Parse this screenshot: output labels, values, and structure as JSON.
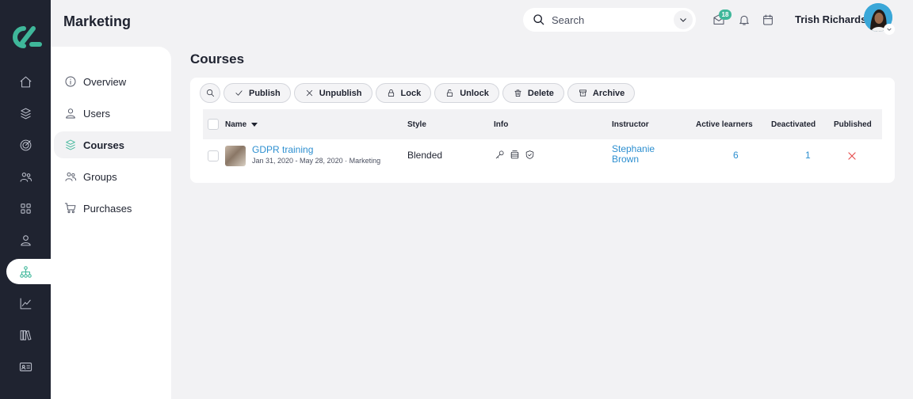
{
  "app": {
    "section_title": "Marketing"
  },
  "rail": {
    "items": [
      {
        "icon": "home-icon"
      },
      {
        "icon": "courses-icon"
      },
      {
        "icon": "target-icon"
      },
      {
        "icon": "groups-icon"
      },
      {
        "icon": "grid-icon"
      },
      {
        "icon": "user-icon"
      },
      {
        "icon": "branches-icon",
        "active": true
      },
      {
        "icon": "chart-icon"
      },
      {
        "icon": "library-icon"
      },
      {
        "icon": "id-card-icon"
      }
    ]
  },
  "subnav": {
    "items": [
      {
        "label": "Overview",
        "icon": "info-icon"
      },
      {
        "label": "Users",
        "icon": "user-icon"
      },
      {
        "label": "Courses",
        "icon": "courses-icon",
        "active": true
      },
      {
        "label": "Groups",
        "icon": "groups-icon"
      },
      {
        "label": "Purchases",
        "icon": "cart-icon"
      }
    ]
  },
  "header": {
    "search_placeholder": "Search",
    "message_badge": "18",
    "user_name": "Trish Richards"
  },
  "page": {
    "title": "Courses"
  },
  "toolbar": {
    "publish": "Publish",
    "unpublish": "Unpublish",
    "lock": "Lock",
    "unlock": "Unlock",
    "delete": "Delete",
    "archive": "Archive"
  },
  "table": {
    "columns": {
      "name": "Name",
      "style": "Style",
      "info": "Info",
      "instructor": "Instructor",
      "active_learners": "Active learners",
      "deactivated": "Deactivated",
      "published": "Published"
    },
    "rows": [
      {
        "name": "GDPR training",
        "meta": "Jan 31, 2020 - May 28, 2020 · Marketing",
        "style": "Blended",
        "instructor": "Stephanie Brown",
        "active_learners": "6",
        "deactivated": "1",
        "published": false
      }
    ]
  },
  "colors": {
    "accent": "#3fb79a",
    "link": "#2d8fd0",
    "rail": "#1f2330",
    "danger": "#e54848"
  }
}
